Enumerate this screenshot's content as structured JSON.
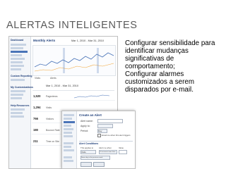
{
  "slide": {
    "title": "ALERTAS INTELIGENTES",
    "paragraphs": [
      "Configurar sensibilidade para identificar mudanças significativas de comportamento;",
      "Configurar alarmes customizados a serem disparados por e-mail."
    ]
  },
  "screenshot_back": {
    "header": "Monthly Alerts",
    "date_range_top": "Mar 1, 2010 - Mar 31, 2010",
    "date_range_mid": "Mar 1, 2010 - Mar 31, 2010",
    "sidebar_top": "Dashboard",
    "sidebar_headings": [
      "Custom Reporting",
      "My Customizations",
      "Help Resources"
    ],
    "legend": [
      "Visits",
      "Alerts"
    ],
    "metrics": [
      {
        "label": "Pageviews",
        "value": "1,520"
      },
      {
        "label": "Visits",
        "value": "1,294"
      },
      {
        "label": "Visitors",
        "value": "766"
      },
      {
        "label": "Bounce Rate",
        "value": "180"
      },
      {
        "label": "Time on Site",
        "value": "211"
      }
    ],
    "accent": "#4a74b8"
  },
  "screenshot_front": {
    "header": "Create an Alert",
    "fields": {
      "alert_name_label": "Alert name:",
      "alert_name_value": "",
      "apply_label": "Apply to:",
      "period_label": "Period:",
      "period_value": "Day",
      "email_checkbox_label": "Email me when this alert triggers",
      "conditions_label": "Alert Conditions",
      "condition_col1": "This applies to",
      "condition_col2": "Alert me when",
      "condition_col3": "Value",
      "condition_row_metric": "Visits",
      "condition_row_op": "% increases more than",
      "condition_row_value": "",
      "condition_row_compare": "Same day in the previous week"
    }
  }
}
